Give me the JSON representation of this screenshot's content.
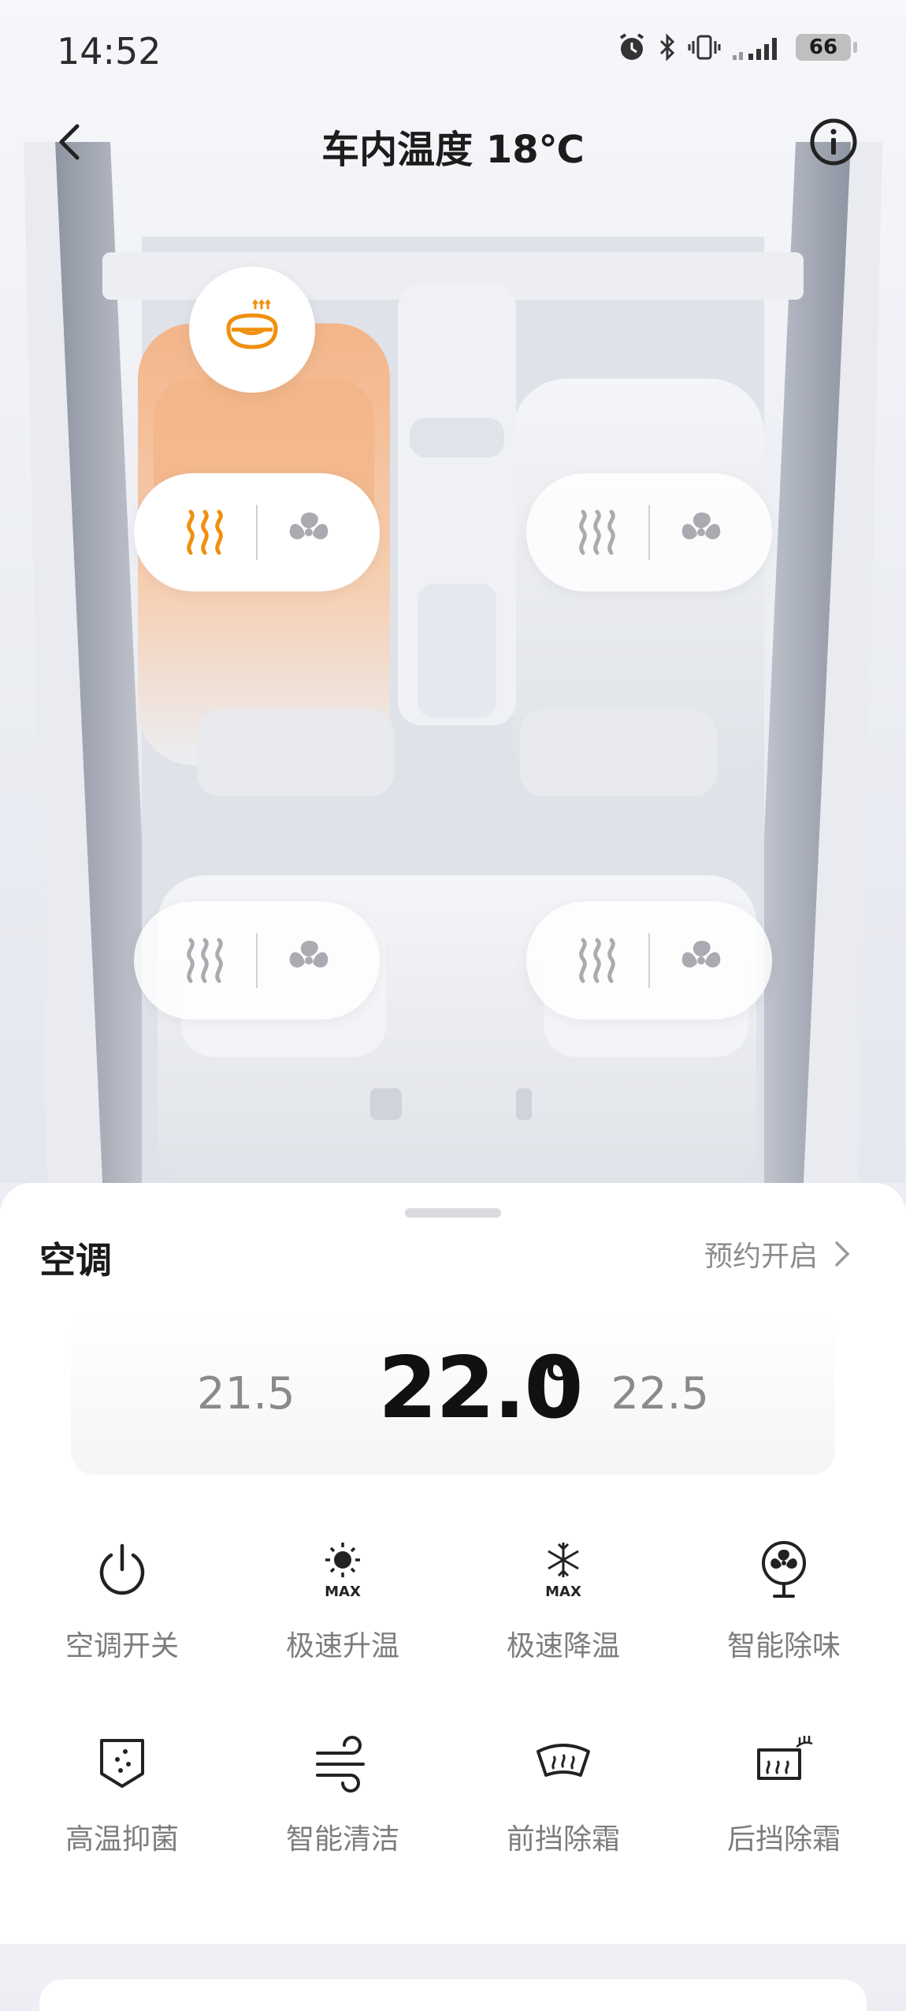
{
  "status_bar": {
    "time": "14:52",
    "battery": "66"
  },
  "header": {
    "title": "车内温度 18℃"
  },
  "seats": {
    "steering_heat": {
      "active": true
    },
    "front_left": {
      "heat_active": true,
      "vent_active": false
    },
    "front_right": {
      "heat_active": false,
      "vent_active": false
    },
    "rear_left": {
      "heat_active": false,
      "vent_active": false
    },
    "rear_right": {
      "heat_active": false,
      "vent_active": false
    }
  },
  "colors": {
    "accent": "#f0900f",
    "inactive_icon": "#a9abb1"
  },
  "ac": {
    "title": "空调",
    "schedule_label": "预约开启",
    "temp_lower": "21.5",
    "temp_current": "22.0",
    "temp_unit": "℃",
    "temp_higher": "22.5"
  },
  "functions": [
    {
      "label": "空调开关",
      "icon": "power-icon"
    },
    {
      "label": "极速升温",
      "icon": "sun-max-icon"
    },
    {
      "label": "极速降温",
      "icon": "snowflake-max-icon"
    },
    {
      "label": "智能除味",
      "icon": "fan-icon"
    },
    {
      "label": "高温抑菌",
      "icon": "shield-dots-icon"
    },
    {
      "label": "智能清洁",
      "icon": "wind-icon"
    },
    {
      "label": "前挡除霜",
      "icon": "front-defrost-icon"
    },
    {
      "label": "后挡除霜",
      "icon": "rear-defrost-icon"
    }
  ]
}
